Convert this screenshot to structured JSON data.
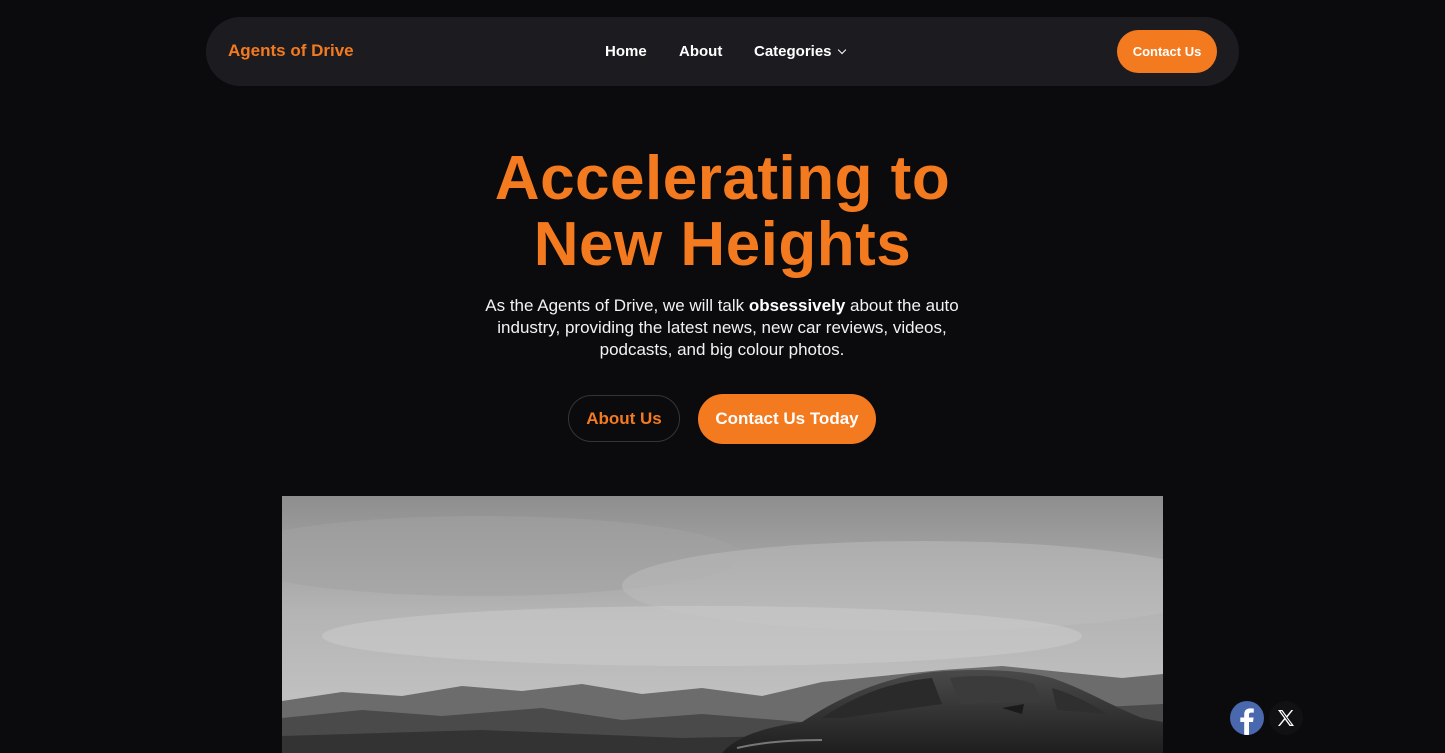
{
  "nav": {
    "brand": "Agents of Drive",
    "links": [
      "Home",
      "About",
      "Categories"
    ],
    "contact_label": "Contact Us"
  },
  "hero": {
    "title_line1": "Accelerating to",
    "title_line2": "New Heights",
    "desc_before": "As the Agents of Drive, we will talk ",
    "desc_bold": "obsessively",
    "desc_after": " about the auto industry, providing the latest news, new car reviews, videos, podcasts, and big colour photos.",
    "btn_about": "About Us",
    "btn_contact": "Contact Us Today"
  },
  "social": {
    "icons": [
      "facebook-icon",
      "x-icon"
    ]
  },
  "colors": {
    "accent": "#f47a1f",
    "background": "#0b0b0d",
    "navbar": "#1c1c20"
  }
}
